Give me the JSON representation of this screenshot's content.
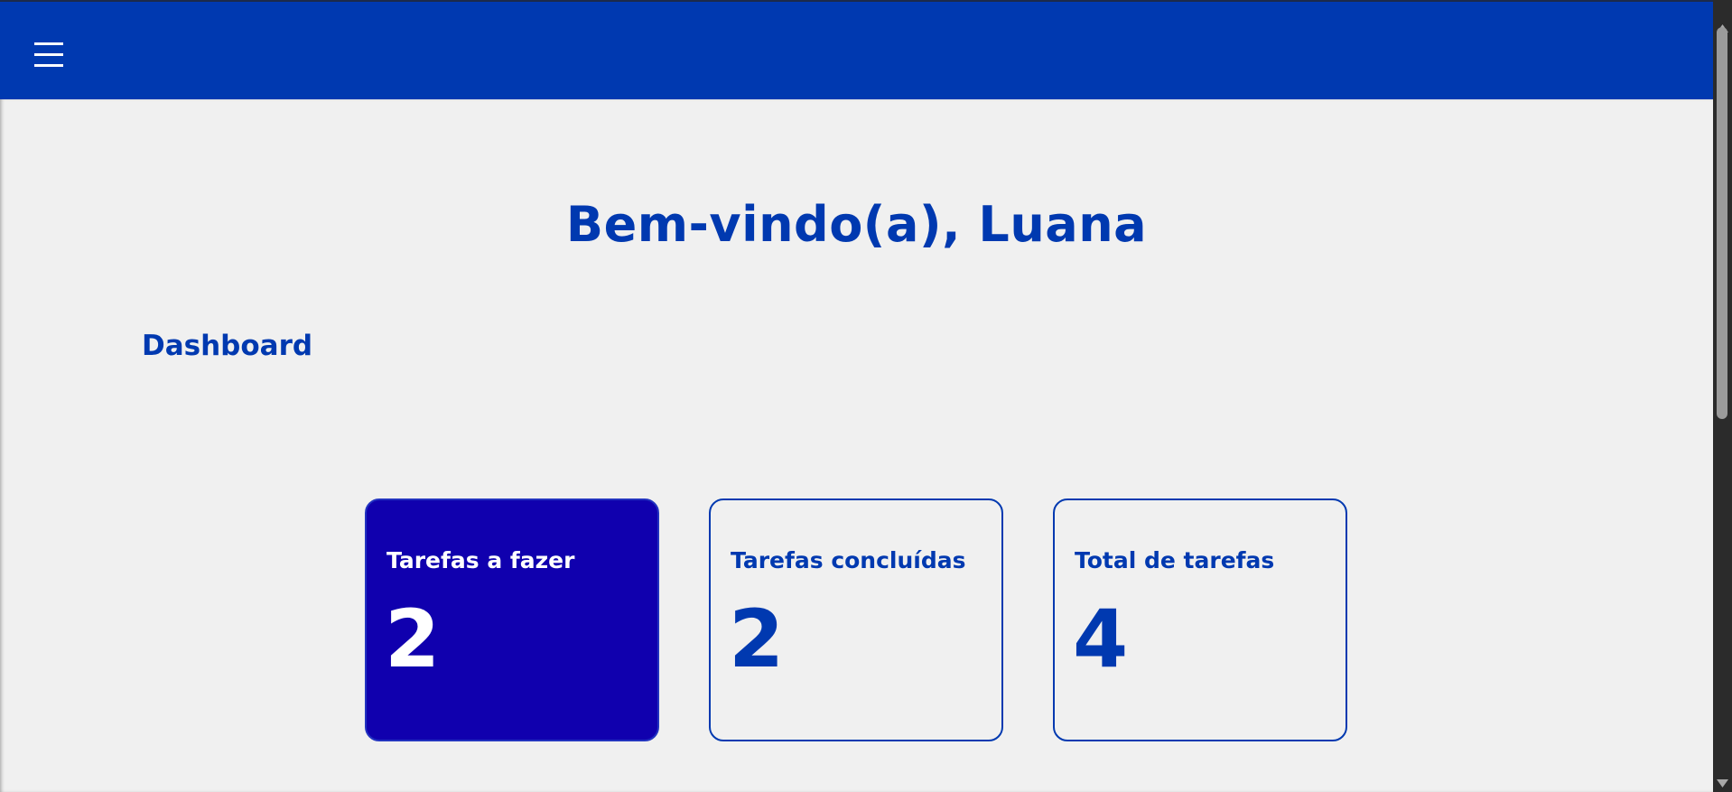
{
  "header": {
    "menu_icon": "hamburger-menu-icon",
    "background_color": "#0039b0"
  },
  "main": {
    "welcome_title": "Bem-vindo(a), Luana",
    "section_title": "Dashboard",
    "cards": [
      {
        "label": "Tarefas a fazer",
        "value": "2"
      },
      {
        "label": "Tarefas concluídas",
        "value": "2"
      },
      {
        "label": "Total de tarefas",
        "value": "4"
      }
    ]
  },
  "colors": {
    "primary": "#0039b0",
    "highlight_card": "#1000ae",
    "background": "#f0f0f0"
  }
}
